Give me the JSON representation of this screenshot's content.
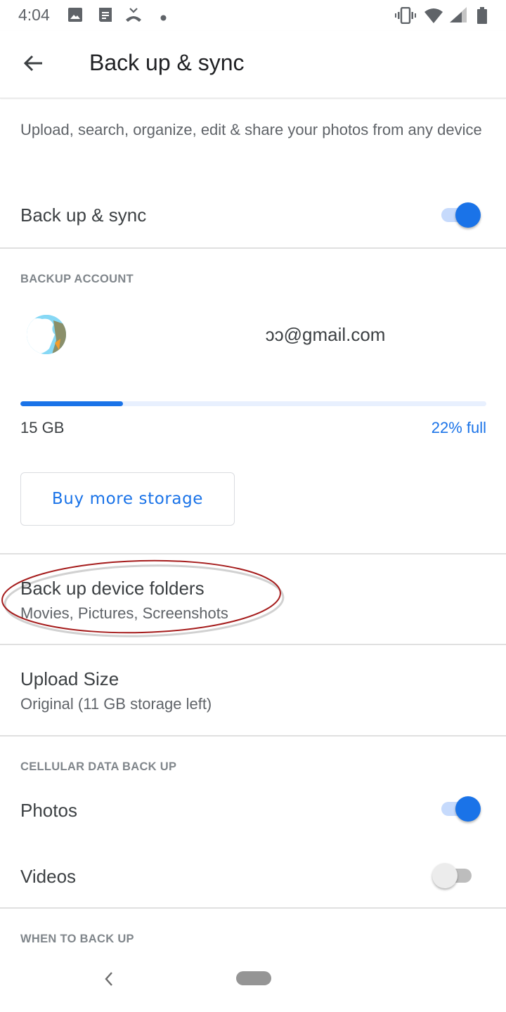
{
  "status_bar": {
    "time": "4:04",
    "left_icons": [
      "image-icon",
      "notes-icon",
      "missed-call-icon",
      "dot-icon"
    ],
    "right_icons": [
      "vibrate-icon",
      "wifi-icon",
      "cell-signal-icon",
      "battery-icon"
    ]
  },
  "app_bar": {
    "title": "Back up & sync",
    "back_icon": "arrow-back-icon"
  },
  "intro": {
    "description": "Upload, search, organize, edit & share your photos from any device"
  },
  "backup_sync": {
    "label": "Back up & sync",
    "enabled": true
  },
  "backup_account": {
    "header": "BACKUP ACCOUNT",
    "email": "                                  ɔɔ@gmail.com",
    "storage_total": "15 GB",
    "storage_percent_label": "22% full",
    "storage_used_fraction": 0.22,
    "buy_button_label": "Buy more storage"
  },
  "device_folders": {
    "title": "Back up device folders",
    "subtitle": "Movies, Pictures, Screenshots"
  },
  "upload_size": {
    "title": "Upload Size",
    "subtitle": "Original (11 GB storage left)"
  },
  "cellular": {
    "header": "CELLULAR DATA BACK UP",
    "items": [
      {
        "label": "Photos",
        "enabled": true
      },
      {
        "label": "Videos",
        "enabled": false
      }
    ]
  },
  "when_to_back_up": {
    "header": "WHEN TO BACK UP"
  },
  "colors": {
    "accent": "#1a73e8",
    "annotation": "#a51c1c"
  }
}
